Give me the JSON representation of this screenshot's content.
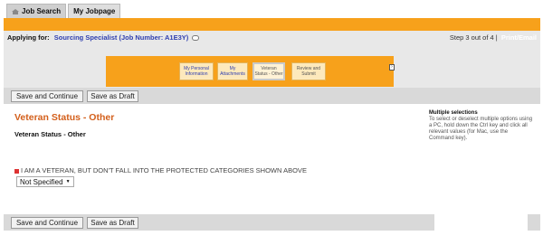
{
  "tabs": [
    {
      "label": "Job Search",
      "icon": "home-icon"
    },
    {
      "label": "My Jobpage"
    }
  ],
  "header": {
    "applying_label": "Applying for:",
    "job_title": "Sourcing Specialist (Job Number: A1E3Y)",
    "step_text": "Step 3 out of 4 |",
    "print_label": "Print/Email"
  },
  "wizard": {
    "steps": [
      {
        "label": "My Personal Information"
      },
      {
        "label": "My Attachments"
      },
      {
        "label": "Veteran Status - Other"
      },
      {
        "label": "Review and Submit"
      }
    ],
    "prev_label": "‹",
    "next_label": "›"
  },
  "actions": {
    "save_continue": "Save and Continue",
    "save_draft": "Save as Draft"
  },
  "content": {
    "title": "Veteran Status - Other",
    "subtitle": "Veteran Status - Other",
    "question": "I AM A VETERAN, BUT DON'T FALL INTO THE PROTECTED CATEGORIES SHOWN ABOVE",
    "select_value": "Not Specified"
  },
  "help": {
    "title": "Multiple selections",
    "body": "To select or deselect multiple options using a PC, hold down the Ctrl key and click all relevant values (for Mac, use the Command key)."
  },
  "colors": {
    "accent": "#f7a11b",
    "title": "#d35f1b",
    "link": "#2f3fb0"
  }
}
